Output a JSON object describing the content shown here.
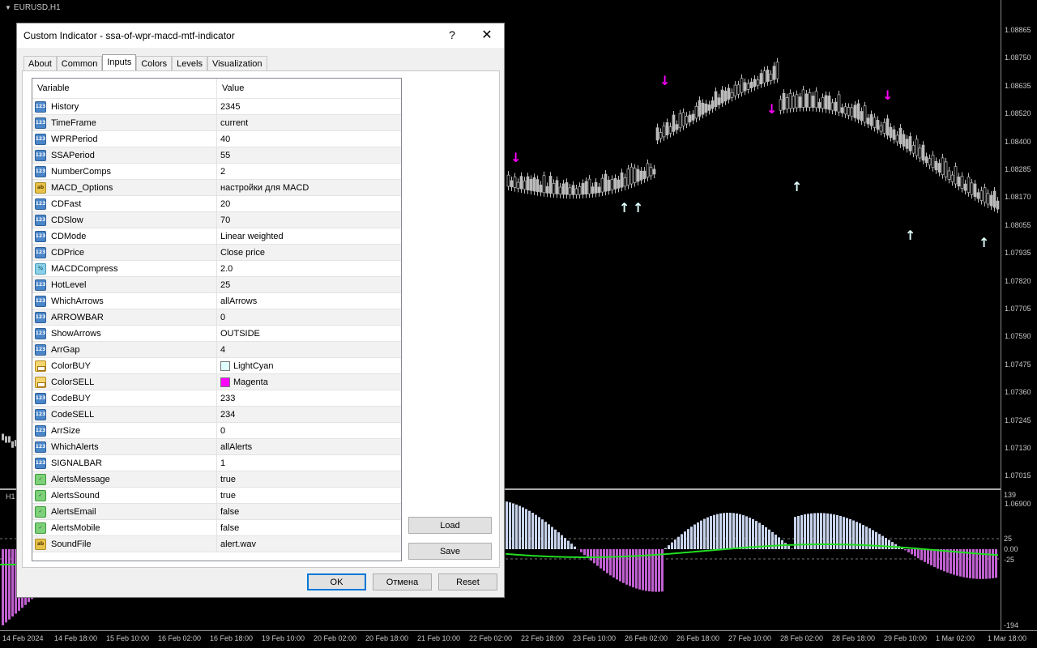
{
  "chart": {
    "symbol": "EURUSD,H1",
    "sub_symbol": "H1",
    "price_labels": [
      "1.08865",
      "1.08750",
      "1.08635",
      "1.08520",
      "1.08400",
      "1.08285",
      "1.08170",
      "1.08055",
      "1.07935",
      "1.07820",
      "1.07705",
      "1.07590",
      "1.07475",
      "1.07360",
      "1.07245",
      "1.07130",
      "1.07015",
      "1.06900"
    ],
    "sub_labels": {
      "top": "139",
      "hot_up": "25",
      "zero": "0.00",
      "hot_down": "-25",
      "bottom": "-194"
    },
    "time_labels": [
      "14 Feb 2024",
      "14 Feb 18:00",
      "15 Feb 10:00",
      "16 Feb 02:00",
      "16 Feb 18:00",
      "19 Feb 10:00",
      "20 Feb 02:00",
      "20 Feb 18:00",
      "21 Feb 10:00",
      "22 Feb 02:00",
      "22 Feb 18:00",
      "23 Feb 10:00",
      "26 Feb 02:00",
      "26 Feb 18:00",
      "27 Feb 10:00",
      "28 Feb 02:00",
      "28 Feb 18:00",
      "29 Feb 10:00",
      "1 Mar 02:00",
      "1 Mar 18:00"
    ],
    "colors": {
      "buy_arrow": "#e0ffff",
      "sell_arrow": "#ff00ff",
      "signal_line": "#22dd22",
      "hist_pos": "#c8d4ec",
      "hist_neg": "#c060d0"
    }
  },
  "dialog": {
    "title": "Custom Indicator - ssa-of-wpr-macd-mtf-indicator",
    "help": "?",
    "close": "✕",
    "tabs": [
      "About",
      "Common",
      "Inputs",
      "Colors",
      "Levels",
      "Visualization"
    ],
    "active_tab": "Inputs",
    "columns": {
      "variable": "Variable",
      "value": "Value"
    },
    "params": [
      {
        "type": "int",
        "name": "History",
        "value": "2345"
      },
      {
        "type": "int",
        "name": "TimeFrame",
        "value": "current"
      },
      {
        "type": "int",
        "name": "WPRPeriod",
        "value": "40"
      },
      {
        "type": "int",
        "name": "SSAPeriod",
        "value": "55"
      },
      {
        "type": "int",
        "name": "NumberComps",
        "value": "2"
      },
      {
        "type": "str",
        "name": "MACD_Options",
        "value": "настройки для MACD"
      },
      {
        "type": "int",
        "name": "CDFast",
        "value": "20"
      },
      {
        "type": "int",
        "name": "CDSlow",
        "value": "70"
      },
      {
        "type": "int",
        "name": "CDMode",
        "value": "Linear weighted"
      },
      {
        "type": "int",
        "name": "CDPrice",
        "value": "Close price"
      },
      {
        "type": "dbl",
        "name": "MACDCompress",
        "value": "2.0"
      },
      {
        "type": "int",
        "name": "HotLevel",
        "value": "25"
      },
      {
        "type": "int",
        "name": "WhichArrows",
        "value": "allArrows"
      },
      {
        "type": "int",
        "name": "ARROWBAR",
        "value": "0"
      },
      {
        "type": "int",
        "name": "ShowArrows",
        "value": "OUTSIDE"
      },
      {
        "type": "int",
        "name": "ArrGap",
        "value": "4"
      },
      {
        "type": "clr",
        "name": "ColorBUY",
        "value": "LightCyan",
        "swatch": "#e0ffff"
      },
      {
        "type": "clr",
        "name": "ColorSELL",
        "value": "Magenta",
        "swatch": "#ff00ff"
      },
      {
        "type": "int",
        "name": "CodeBUY",
        "value": "233"
      },
      {
        "type": "int",
        "name": "CodeSELL",
        "value": "234"
      },
      {
        "type": "int",
        "name": "ArrSize",
        "value": "0"
      },
      {
        "type": "int",
        "name": "WhichAlerts",
        "value": "allAlerts"
      },
      {
        "type": "int",
        "name": "SIGNALBAR",
        "value": "1"
      },
      {
        "type": "bool",
        "name": "AlertsMessage",
        "value": "true"
      },
      {
        "type": "bool",
        "name": "AlertsSound",
        "value": "true"
      },
      {
        "type": "bool",
        "name": "AlertsEmail",
        "value": "false"
      },
      {
        "type": "bool",
        "name": "AlertsMobile",
        "value": "false"
      },
      {
        "type": "str",
        "name": "SoundFile",
        "value": "alert.wav"
      }
    ],
    "icon_text": {
      "int": "123",
      "str": "ab",
      "dbl": "½",
      "bool": "✓",
      "clr": ""
    },
    "buttons": {
      "load": "Load",
      "save": "Save",
      "ok": "OK",
      "cancel": "Отмена",
      "reset": "Reset"
    }
  }
}
